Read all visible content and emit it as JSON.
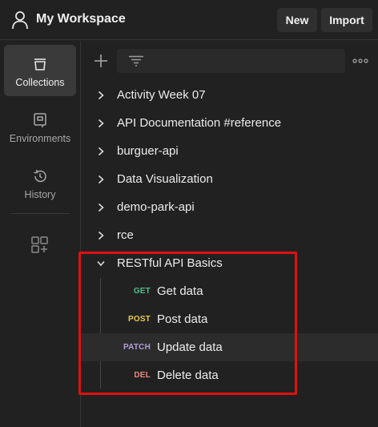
{
  "header": {
    "workspace_title": "My Workspace",
    "new_label": "New",
    "import_label": "Import"
  },
  "sidebar": {
    "items": [
      {
        "label": "Collections",
        "icon": "collections-icon",
        "active": true
      },
      {
        "label": "Environments",
        "icon": "environments-icon",
        "active": false
      },
      {
        "label": "History",
        "icon": "history-icon",
        "active": false
      }
    ],
    "addon_icon": "add-apps-icon"
  },
  "collections": [
    {
      "name": "Activity Week 07",
      "expanded": false
    },
    {
      "name": "API Documentation #reference",
      "expanded": false
    },
    {
      "name": "burguer-api",
      "expanded": false
    },
    {
      "name": "Data Visualization",
      "expanded": false
    },
    {
      "name": "demo-park-api",
      "expanded": false
    },
    {
      "name": "rce",
      "expanded": false
    },
    {
      "name": "RESTful API Basics",
      "expanded": true
    }
  ],
  "requests": [
    {
      "method": "GET",
      "name": "Get data",
      "method_color": "#4fc18a"
    },
    {
      "method": "POST",
      "name": "Post data",
      "method_color": "#e7c94a"
    },
    {
      "method": "PATCH",
      "name": "Update data",
      "method_color": "#b39ddb",
      "hovered": true
    },
    {
      "method": "DEL",
      "name": "Delete data",
      "method_color": "#e88a7c"
    }
  ],
  "colors": {
    "background": "#212121",
    "active_sidebar": "#3a3a3a",
    "highlight": "#e01010"
  }
}
